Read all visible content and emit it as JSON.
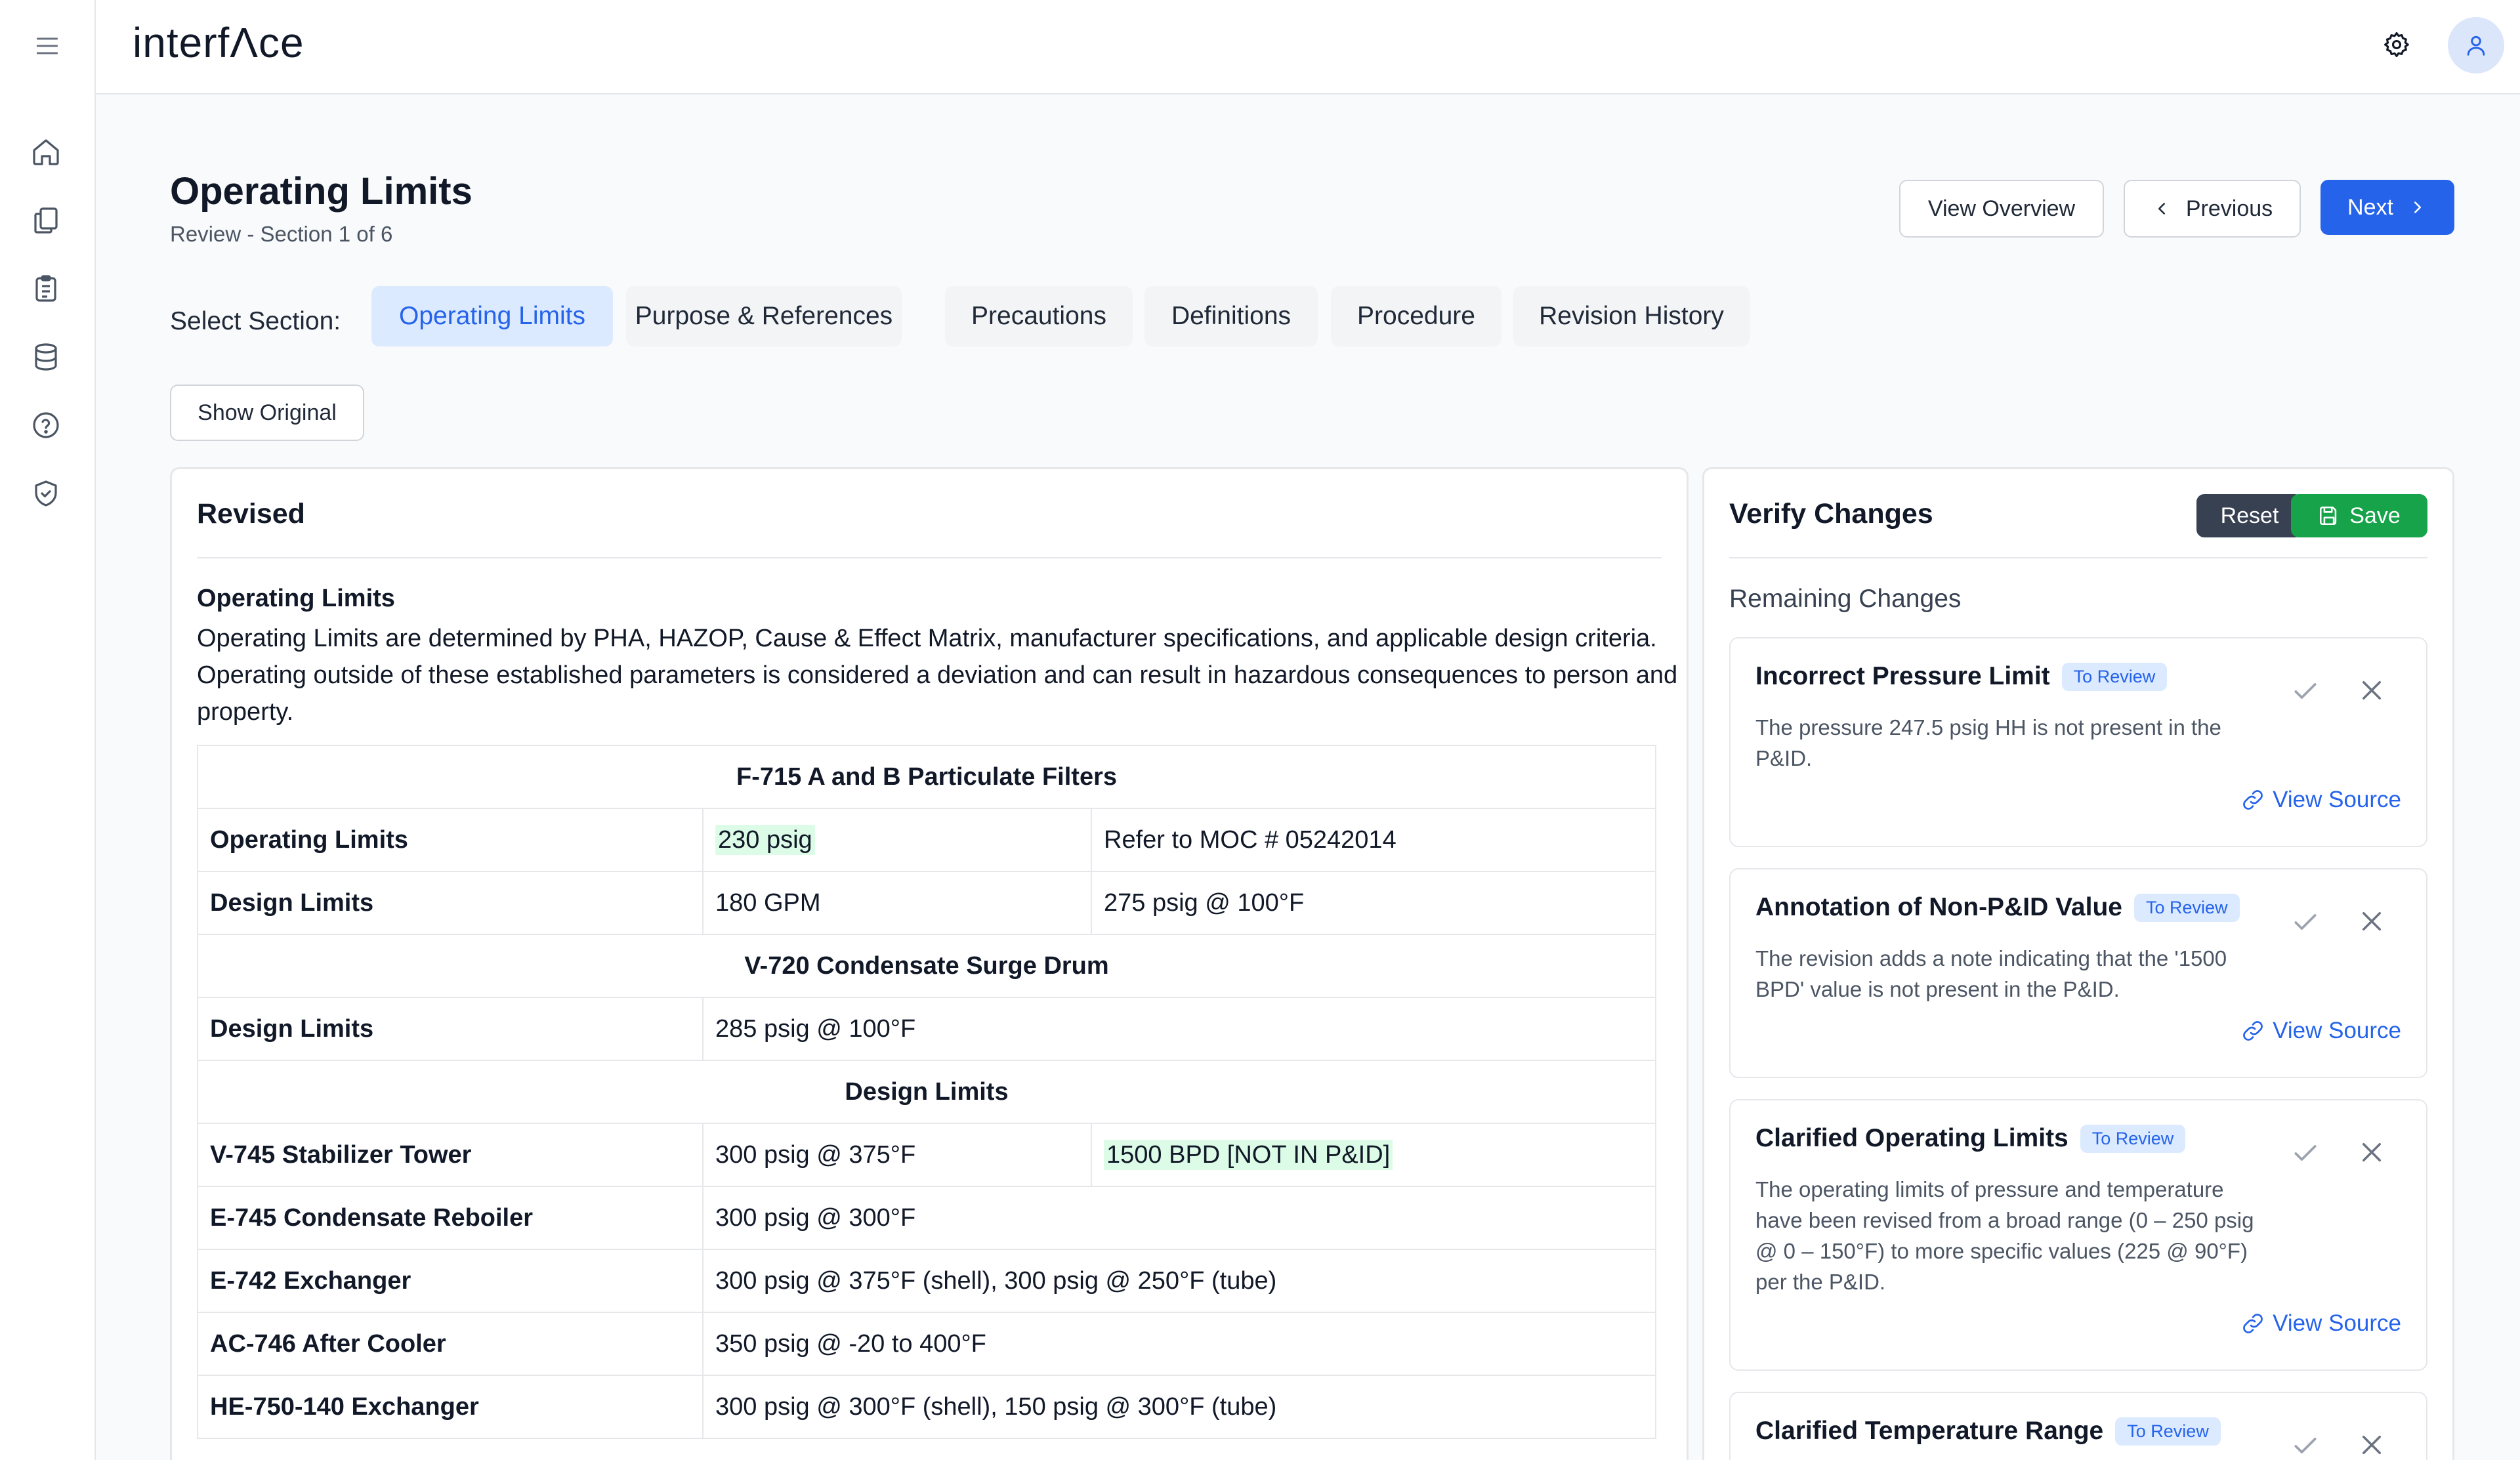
{
  "app": {
    "logo": "interfΛce"
  },
  "page": {
    "title": "Operating Limits",
    "subtitle": "Review - Section 1 of 6"
  },
  "nav": {
    "view_overview": "View Overview",
    "previous": "Previous",
    "next": "Next"
  },
  "sections": {
    "label": "Select Section:",
    "tabs": [
      "Operating Limits",
      "Purpose & References",
      "Precautions",
      "Definitions",
      "Procedure",
      "Revision History"
    ],
    "active": "Operating Limits"
  },
  "show_original": "Show Original",
  "revised": {
    "title": "Revised",
    "heading": "Operating Limits",
    "paragraph": "Operating Limits are determined by PHA, HAZOP, Cause & Effect Matrix, manufacturer specifications, and applicable design criteria. Operating outside of these established parameters is considered a deviation and can result in hazardous consequences to person and property.",
    "table": {
      "h1": "F-715 A and B Particulate Filters",
      "r1": [
        "Operating Limits",
        "230 psig",
        "Refer to MOC # 05242014"
      ],
      "r2": [
        "Design Limits",
        "180 GPM",
        "275 psig @ 100°F"
      ],
      "h2": "V-720 Condensate Surge Drum",
      "r3": [
        "Design Limits",
        "285 psig @ 100°F"
      ],
      "h3": "Design Limits",
      "r4": [
        "V-745 Stabilizer Tower",
        "300 psig @ 375°F",
        "1500 BPD [NOT IN P&ID]"
      ],
      "r5": [
        "E-745 Condensate Reboiler",
        "300 psig @ 300°F"
      ],
      "r6": [
        "E-742 Exchanger",
        "300 psig @ 375°F (shell), 300 psig @ 250°F (tube)"
      ],
      "r7": [
        "AC-746 After Cooler",
        "350 psig @ -20 to 400°F"
      ],
      "r8": [
        "HE-750-140 Exchanger",
        "300 psig @ 300°F (shell), 150 psig @ 300°F (tube)"
      ]
    }
  },
  "verify": {
    "title": "Verify Changes",
    "reset": "Reset",
    "save": "Save",
    "remaining": "Remaining Changes",
    "view_source": "View Source",
    "cards": [
      {
        "title": "Incorrect Pressure Limit",
        "badge": "To Review",
        "desc": "The pressure 247.5 psig HH is not present in the P&ID."
      },
      {
        "title": "Annotation of Non-P&ID Value",
        "badge": "To Review",
        "desc": "The revision adds a note indicating that the '1500 BPD' value is not present in the P&ID."
      },
      {
        "title": "Clarified Operating Limits",
        "badge": "To Review",
        "desc": "The operating limits of pressure and temperature have been revised from a broad range (0 – 250 psig @ 0 – 150°F) to more specific values (225 @ 90°F) per the P&ID."
      },
      {
        "title": "Clarified Temperature Range",
        "badge": "To Review"
      }
    ]
  }
}
